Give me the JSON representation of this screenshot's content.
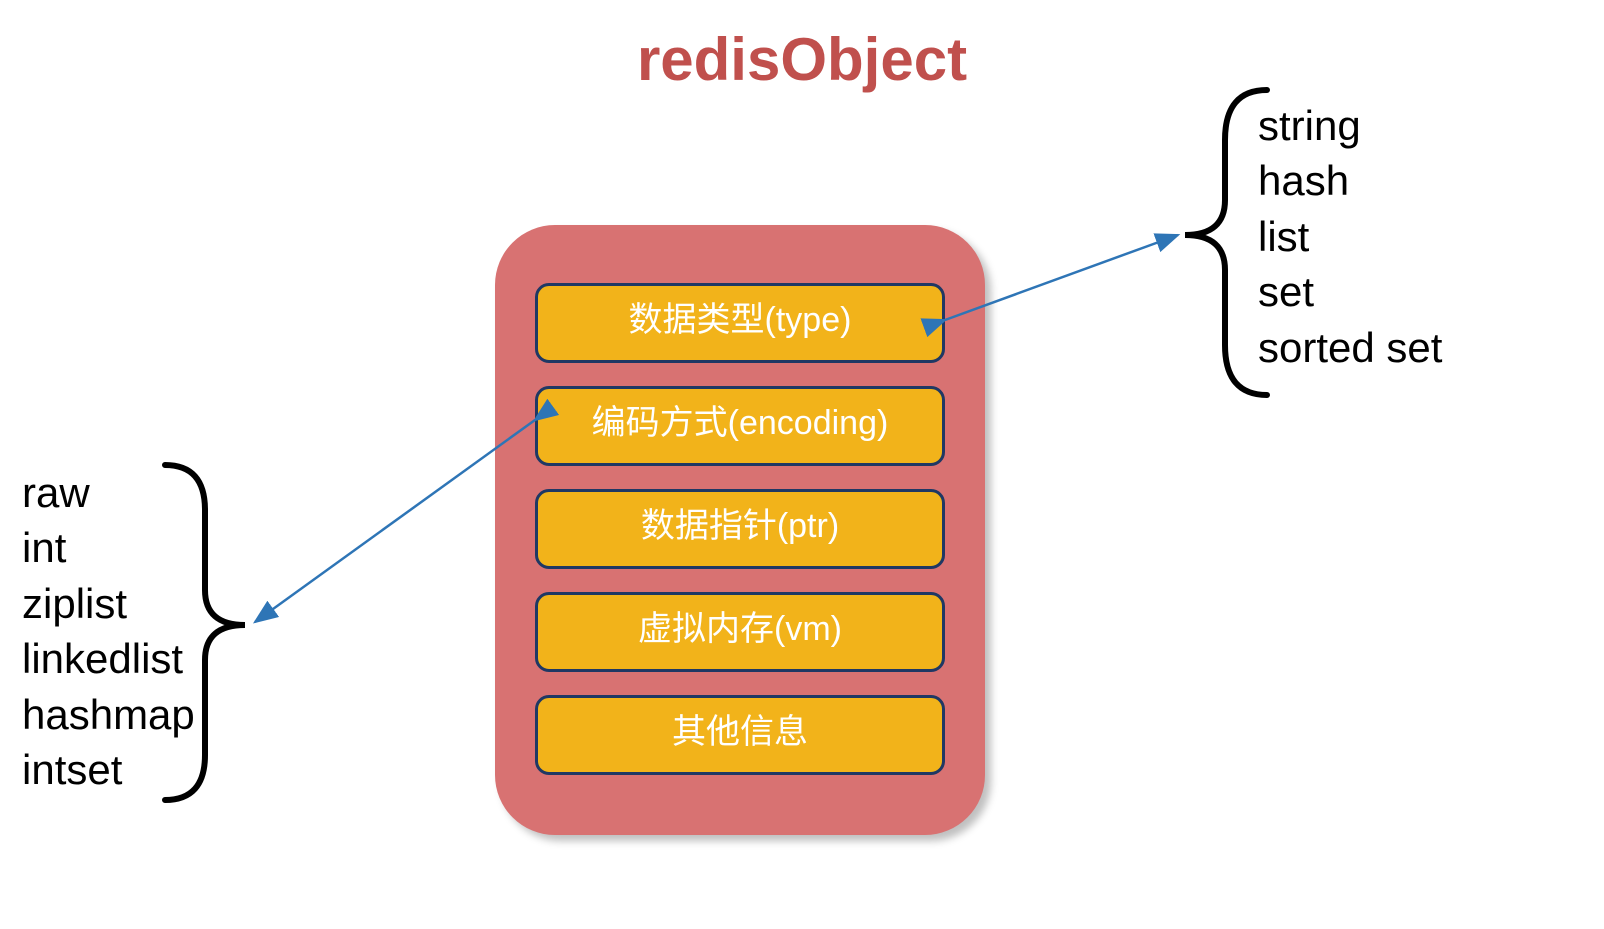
{
  "title": "redisObject",
  "panel": {
    "fields": [
      "数据类型(type)",
      "编码方式(encoding)",
      "数据指针(ptr)",
      "虚拟内存(vm)",
      "其他信息"
    ]
  },
  "type_list": [
    "string",
    "hash",
    "list",
    "set",
    "sorted set"
  ],
  "encoding_list": [
    "raw",
    "int",
    "ziplist",
    "linkedlist",
    "hashmap",
    "intset"
  ],
  "colors": {
    "title": "#c0504d",
    "panel_bg": "#d87272",
    "field_bg": "#f2b31a",
    "field_border": "#1f3864",
    "arrow": "#2e75b6"
  }
}
